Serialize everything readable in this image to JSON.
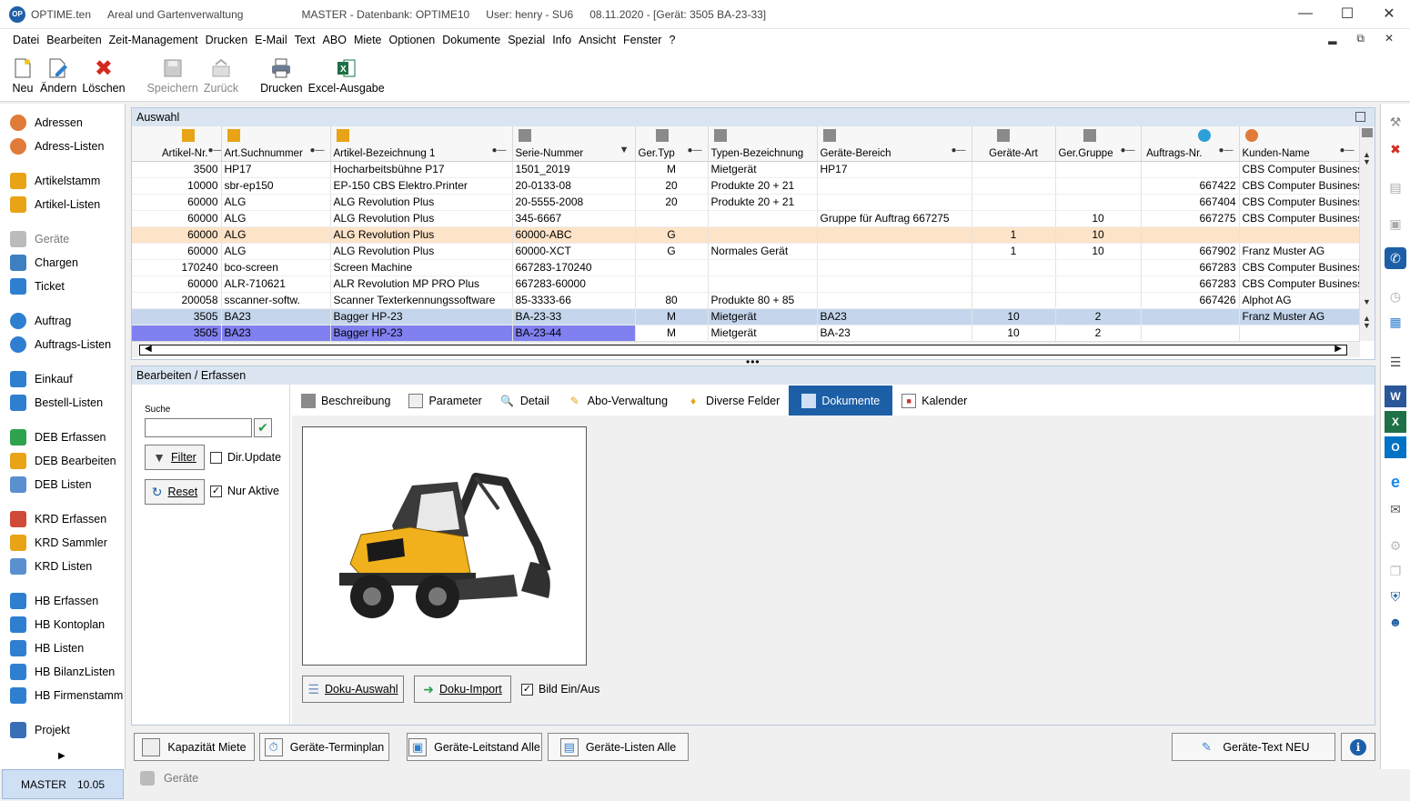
{
  "titlebar": {
    "app": "OPTIME.ten",
    "module": "Areal und Gartenverwaltung",
    "db": "MASTER - Datenbank:  OPTIME10",
    "user": "User:  henry  -  SU6",
    "info": "08.11.2020 - [Gerät: 3505  BA-23-33]",
    "icon_text": "OP"
  },
  "menu": [
    "Datei",
    "Bearbeiten",
    "Zeit-Management",
    "Drucken",
    "E-Mail",
    "Text",
    "ABO",
    "Miete",
    "Optionen",
    "Dokumente",
    "Spezial",
    "Info",
    "Ansicht",
    "Fenster",
    "?"
  ],
  "toolbar": {
    "new": "Neu",
    "edit": "Ändern",
    "delete": "Löschen",
    "save": "Speichern",
    "back": "Zurück",
    "print": "Drucken",
    "excel": "Excel-Ausgabe"
  },
  "sidebar": [
    {
      "label": "Adressen",
      "icon": "people-icon",
      "color": "#e07b39"
    },
    {
      "label": "Adress-Listen",
      "icon": "people-list-icon",
      "color": "#e07b39"
    },
    {
      "label": "Artikelstamm",
      "icon": "box-icon",
      "color": "#e8a317"
    },
    {
      "label": "Artikel-Listen",
      "icon": "box-list-icon",
      "color": "#e8a317"
    },
    {
      "label": "Geräte",
      "icon": "device-icon",
      "color": "#9a9a9a"
    },
    {
      "label": "Chargen",
      "icon": "cube-icon",
      "color": "#3d7fc1"
    },
    {
      "label": "Ticket",
      "icon": "ticket-icon",
      "color": "#2f7fd1"
    },
    {
      "label": "Auftrag",
      "icon": "order-icon",
      "color": "#2f7fd1"
    },
    {
      "label": "Auftrags-Listen",
      "icon": "order-list-icon",
      "color": "#2f7fd1"
    },
    {
      "label": "Einkauf",
      "icon": "cart-icon",
      "color": "#2f7fd1"
    },
    {
      "label": "Bestell-Listen",
      "icon": "cart-list-icon",
      "color": "#2f7fd1"
    },
    {
      "label": "DEB Erfassen",
      "icon": "deb-add-icon",
      "color": "#2fa34e"
    },
    {
      "label": "DEB Bearbeiten",
      "icon": "deb-edit-icon",
      "color": "#e8a317"
    },
    {
      "label": "DEB Listen",
      "icon": "deb-list-icon",
      "color": "#5a8fd0"
    },
    {
      "label": "KRD Erfassen",
      "icon": "krd-add-icon",
      "color": "#d04a3a"
    },
    {
      "label": "KRD Sammler",
      "icon": "krd-collect-icon",
      "color": "#e8a317"
    },
    {
      "label": "KRD Listen",
      "icon": "krd-list-icon",
      "color": "#5a8fd0"
    },
    {
      "label": "HB Erfassen",
      "icon": "hb-add-icon",
      "color": "#2f7fd1"
    },
    {
      "label": "HB Kontoplan",
      "icon": "hb-plan-icon",
      "color": "#2f7fd1"
    },
    {
      "label": "HB Listen",
      "icon": "hb-list-icon",
      "color": "#2f7fd1"
    },
    {
      "label": "HB BilanzListen",
      "icon": "hb-balance-icon",
      "color": "#2f7fd1"
    },
    {
      "label": "HB Firmenstamm",
      "icon": "hb-company-icon",
      "color": "#2f7fd1"
    },
    {
      "label": "Projekt",
      "icon": "project-icon",
      "color": "#3a6fb7"
    }
  ],
  "status": {
    "db": "MASTER",
    "version": "10.05",
    "module": "Geräte"
  },
  "auswahl": {
    "title": "Auswahl",
    "columns": [
      "Artikel-Nr.",
      "Art.Suchnummer",
      "Artikel-Bezeichnung 1",
      "Serie-Nummer",
      "Ger.Typ",
      "Typen-Bezeichnung",
      "Geräte-Bereich",
      "Geräte-Art",
      "Ger.Gruppe",
      "Auftrags-Nr.",
      "Kunden-Name"
    ],
    "rows": [
      [
        "3500",
        "HP17",
        "Hocharbeitsbühne P17",
        "1501_2019",
        "M",
        "Mietgerät",
        "HP17",
        "",
        "",
        "",
        "CBS Computer Business"
      ],
      [
        "10000",
        "sbr-ep150",
        "EP-150 CBS Elektro.Printer",
        "20-0133-08",
        "20",
        "Produkte 20 + 21",
        "",
        "",
        "",
        "667422",
        "CBS Computer Business"
      ],
      [
        "60000",
        "ALG",
        "ALG Revolution Plus",
        "20-5555-2008",
        "20",
        "Produkte 20 + 21",
        "",
        "",
        "",
        "667404",
        "CBS Computer Business"
      ],
      [
        "60000",
        "ALG",
        "ALG Revolution Plus",
        "345-6667",
        "",
        "",
        "Gruppe für Auftrag 667275",
        "",
        "10",
        "667275",
        "CBS Computer Business"
      ],
      [
        "60000",
        "ALG",
        "ALG Revolution Plus",
        "60000-ABC",
        "G",
        "",
        "",
        "1",
        "10",
        "",
        ""
      ],
      [
        "60000",
        "ALG",
        "ALG Revolution Plus",
        "60000-XCT",
        "G",
        "Normales Gerät",
        "",
        "1",
        "10",
        "667902",
        "Franz Muster AG"
      ],
      [
        "170240",
        "bco-screen",
        "Screen Machine",
        "667283-170240",
        "",
        "",
        "",
        "",
        "",
        "667283",
        "CBS Computer Business"
      ],
      [
        "60000",
        "ALR-710621",
        "ALR Revolution MP PRO Plus",
        "667283-60000",
        "",
        "",
        "",
        "",
        "",
        "667283",
        "CBS Computer Business"
      ],
      [
        "200058",
        "sscanner-softw.",
        "Scanner Texterkennungssoftware",
        "85-3333-66",
        "80",
        "Produkte 80 + 85",
        "",
        "",
        "",
        "667426",
        "Alphot AG"
      ],
      [
        "3505",
        "BA23",
        "Bagger HP-23",
        "BA-23-33",
        "M",
        "Mietgerät",
        "BA23",
        "10",
        "2",
        "",
        "Franz Muster AG"
      ],
      [
        "3505",
        "BA23",
        "Bagger HP-23",
        "BA-23-44",
        "M",
        "Mietgerät",
        "BA-23",
        "10",
        "2",
        "",
        ""
      ]
    ]
  },
  "bearbeiten": {
    "title": "Bearbeiten / Erfassen",
    "search_label": "Suche",
    "search_value": "",
    "filter": "Filter",
    "dir_update": "Dir.Update",
    "reset": "Reset",
    "nur_aktive": "Nur Aktive",
    "tabs": [
      "Beschreibung",
      "Parameter",
      "Detail",
      "Abo-Verwaltung",
      "Diverse Felder",
      "Dokumente",
      "Kalender"
    ],
    "active_tab": "Dokumente",
    "doku_auswahl": "Doku-Auswahl",
    "doku_import": "Doku-Import",
    "bild_toggle": "Bild Ein/Aus"
  },
  "bottom_buttons": {
    "kapazitaet": "Kapazität Miete",
    "terminplan": "Geräte-Terminplan",
    "leitstand": "Geräte-Leitstand Alle",
    "listen": "Geräte-Listen Alle",
    "text_neu": "Geräte-Text NEU"
  }
}
